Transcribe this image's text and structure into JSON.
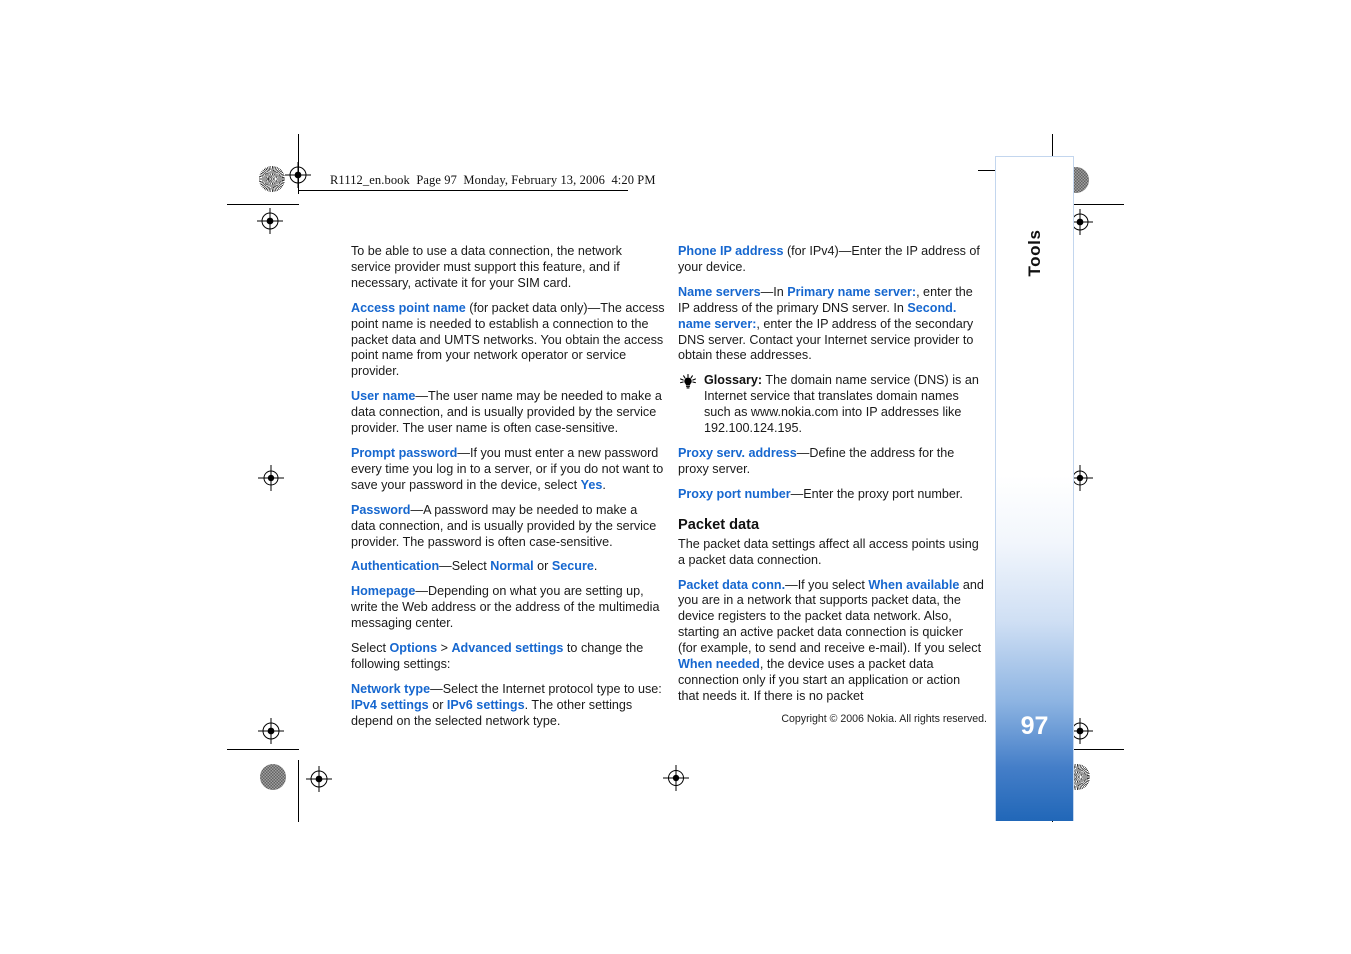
{
  "header": {
    "slug": "R1112_en.book  Page 97  Monday, February 13, 2006  4:20 PM"
  },
  "side_tab": {
    "label": "Tools",
    "page_number": "97",
    "accent_color": "#2167b8"
  },
  "footer": {
    "copyright": "Copyright © 2006 Nokia. All rights reserved."
  },
  "colors": {
    "link_blue": "#1667cf",
    "body_text": "#1a1a1a"
  },
  "left_column": {
    "p1": {
      "text": "To be able to use a data connection, the network service provider must support this feature, and if necessary, activate it for your SIM card."
    },
    "p2": {
      "term": "Access point name",
      "text": " (for packet data only)—The access point name is needed to establish a connection to the packet data and UMTS networks. You obtain the access point name from your network operator or service provider."
    },
    "p3": {
      "term": "User name",
      "text": "—The user name may be needed to make a data connection, and is usually provided by the service provider. The user name is often case-sensitive."
    },
    "p4": {
      "term": "Prompt password",
      "text_a": "—If you must enter a new password every time you log in to a server, or if you do not want to save your password in the device, select ",
      "value": "Yes",
      "text_b": "."
    },
    "p5": {
      "term": "Password",
      "text": "—A password may be needed to make a data connection, and is usually provided by the service provider. The password is often case-sensitive."
    },
    "p6": {
      "term": "Authentication",
      "text_a": "—Select ",
      "value_a": "Normal",
      "text_b": " or ",
      "value_b": "Secure",
      "text_c": "."
    },
    "p7": {
      "term": "Homepage",
      "text": "—Depending on what you are setting up, write the Web address or the address of the multimedia messaging center."
    },
    "p8": {
      "text_a": "Select ",
      "value_a": "Options",
      "text_b": " > ",
      "value_b": "Advanced settings",
      "text_c": " to change the following settings:"
    },
    "p9": {
      "term": "Network type",
      "text_a": "—Select the Internet protocol type to use: ",
      "value_a": "IPv4 settings",
      "text_b": " or ",
      "value_b": "IPv6 settings",
      "text_c": ". The other settings depend on the selected network type."
    }
  },
  "right_column": {
    "p1": {
      "term": "Phone IP address",
      "text": " (for IPv4)—Enter the IP address of your device."
    },
    "p2": {
      "term": "Name servers",
      "text_a": "—In ",
      "value_a": "Primary name server:",
      "text_b": ", enter the IP address of the primary DNS server. In ",
      "value_b": "Second. name server:",
      "text_c": ", enter the IP address of the secondary DNS server. Contact your Internet service provider to obtain these addresses."
    },
    "glossary": {
      "icon": "tip-bulb-icon",
      "label": "Glossary:",
      "text": " The domain name service (DNS) is an Internet service that translates domain names such as www.nokia.com into IP addresses like 192.100.124.195."
    },
    "p3": {
      "term": "Proxy serv. address",
      "text": "—Define the address for the proxy server."
    },
    "p4": {
      "term": "Proxy port number",
      "text": "—Enter the proxy port number."
    },
    "heading": "Packet data",
    "p5": {
      "text": "The packet data settings affect all access points using a packet data connection."
    },
    "p6": {
      "term": "Packet data conn.",
      "text_a": "—If you select ",
      "value_a": "When available",
      "text_b": " and you are in a network that supports packet data, the device registers to the packet data network. Also, starting an active packet data connection is quicker (for example, to send and receive e-mail). If you select ",
      "value_b": "When needed",
      "text_c": ", the device uses a packet data connection only if you start an application or action that needs it. If there is no packet"
    }
  }
}
